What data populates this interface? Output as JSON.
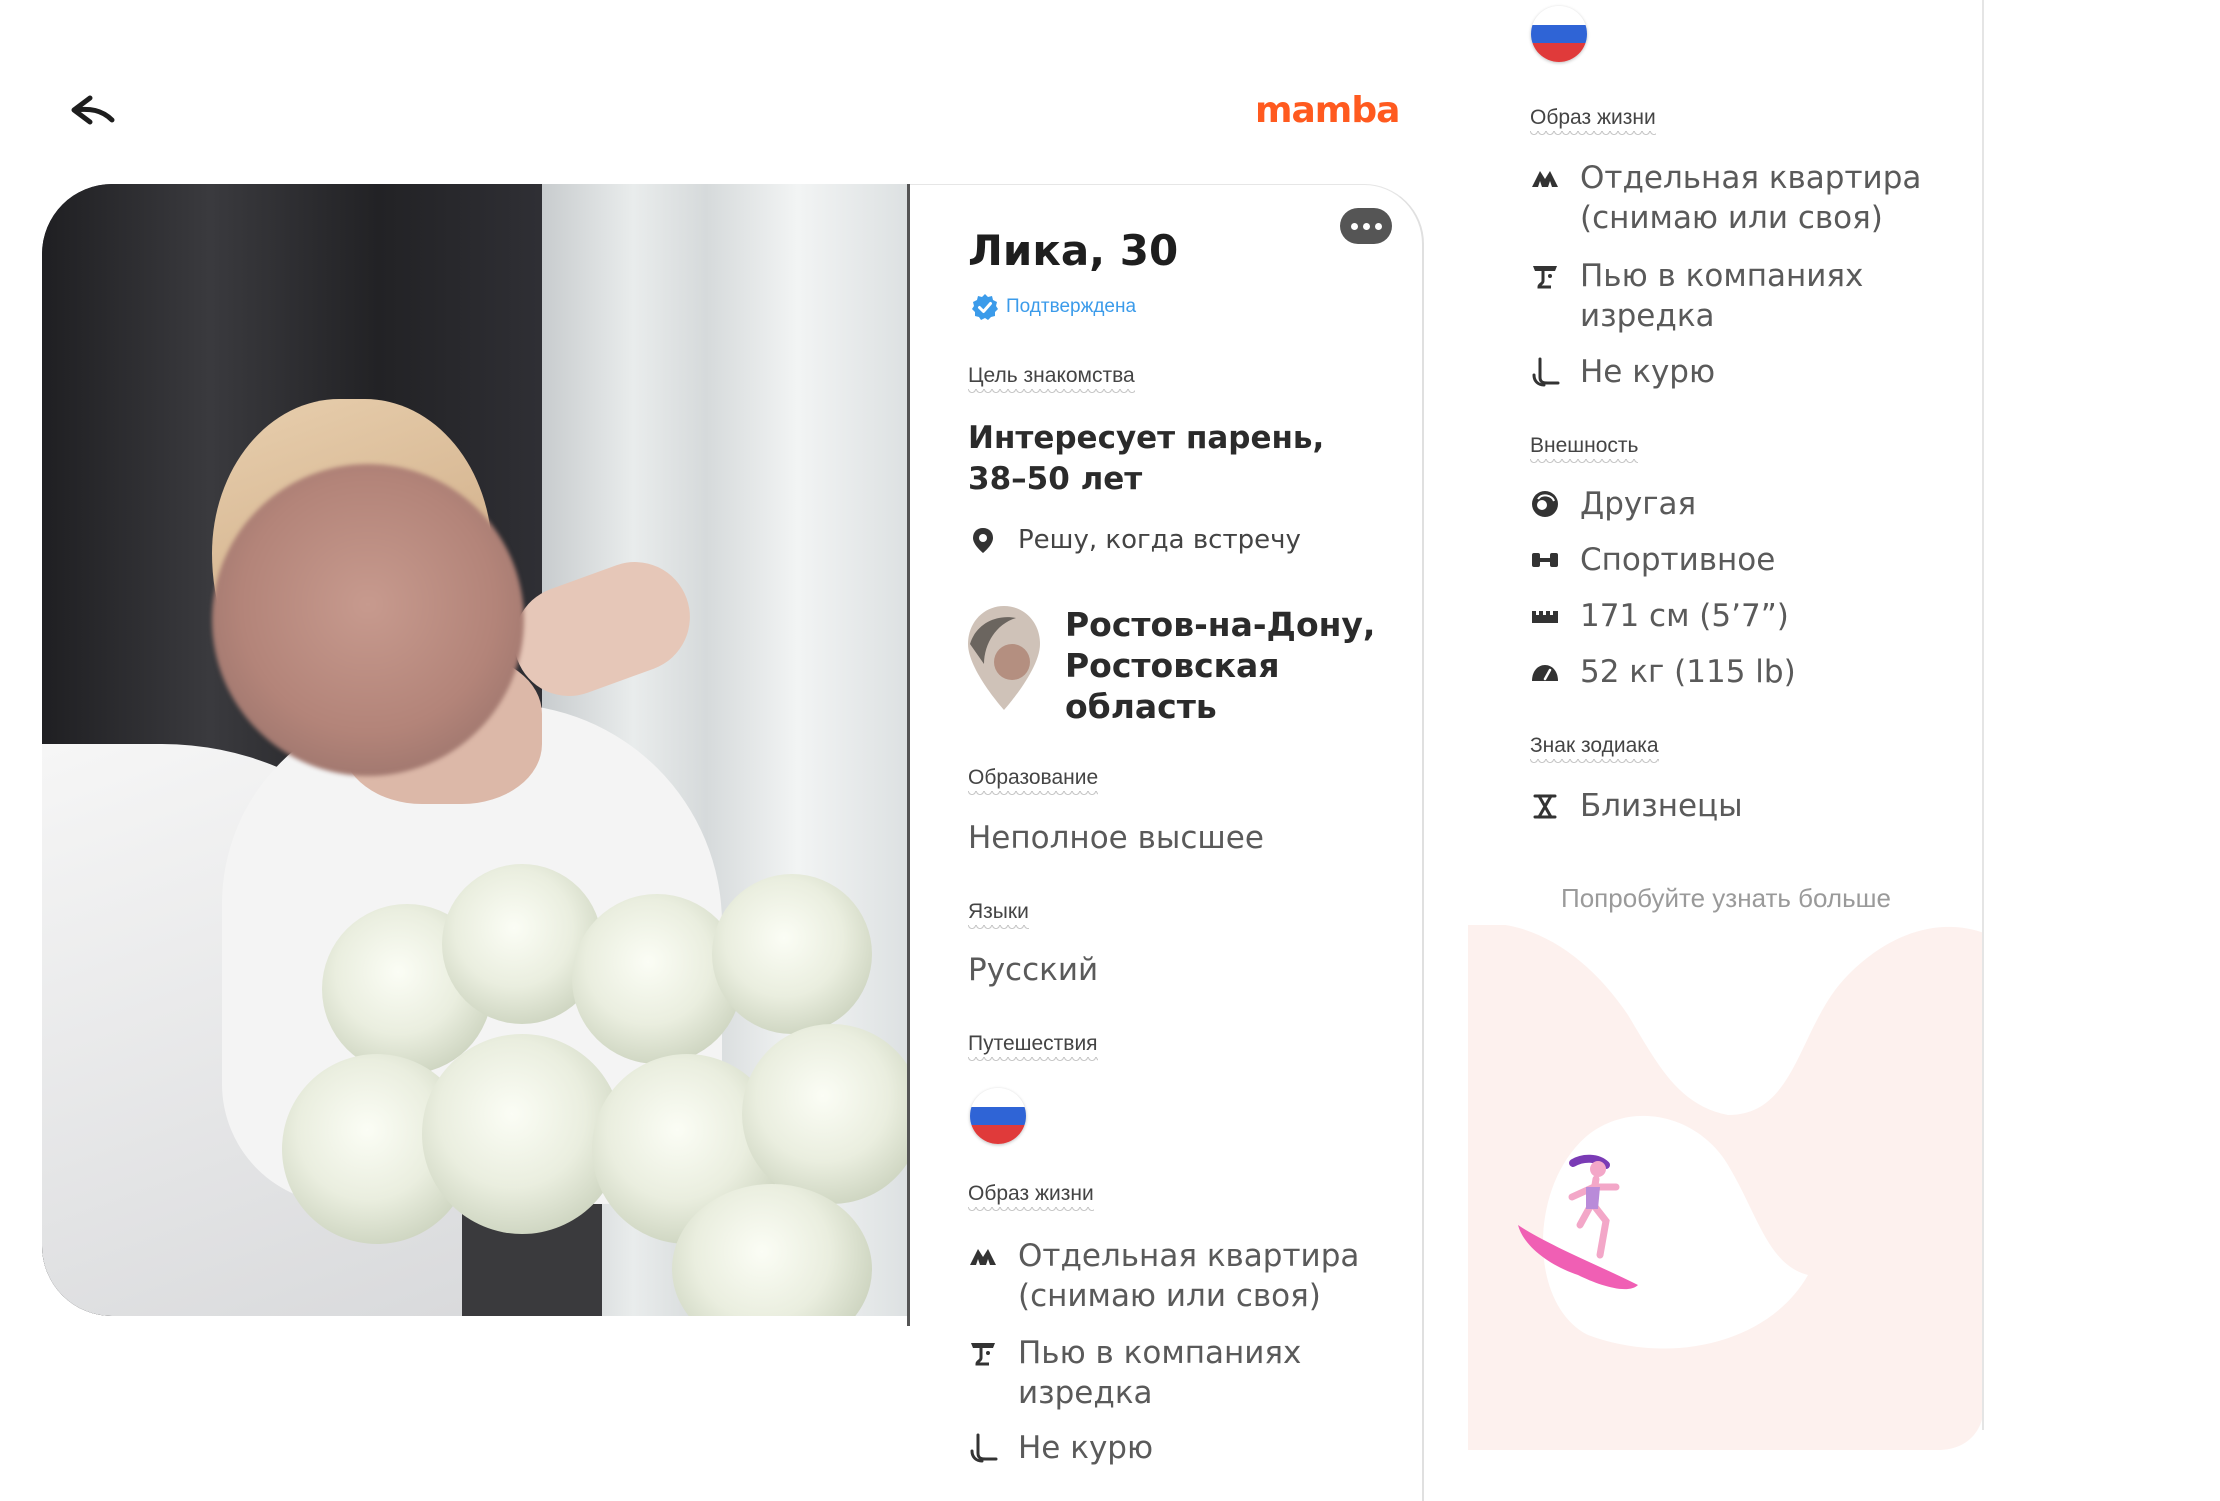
{
  "header": {
    "logo": "mamba",
    "back_icon": "arrow-left-icon"
  },
  "profile": {
    "name_age": "Лика, 30",
    "verified_label": "Подтверждена",
    "menu_icon": "more-dots-icon"
  },
  "goal": {
    "label": "Цель знакомства",
    "text": "Интересует парень, 38–50 лет",
    "meeting": "Решу, когда встречу"
  },
  "location": {
    "text": "Ростов-на-Дону, Ростовская область"
  },
  "education": {
    "label": "Образование",
    "value": "Неполное высшее"
  },
  "languages": {
    "label": "Языки",
    "value": "Русский"
  },
  "travel": {
    "label": "Путешествия",
    "flag": "russia-flag"
  },
  "lifestyle": {
    "label": "Образ жизни",
    "items": [
      {
        "icon": "housing-icon",
        "text": "Отдельная квартира (снимаю или своя)"
      },
      {
        "icon": "drink-icon",
        "text": "Пью в компаниях изредка"
      },
      {
        "icon": "no-smoking-icon",
        "text": "Не курю"
      }
    ]
  },
  "appearance": {
    "label": "Внешность",
    "items": [
      {
        "icon": "face-icon",
        "text": "Другая"
      },
      {
        "icon": "dumbbell-icon",
        "text": "Спортивное"
      },
      {
        "icon": "ruler-icon",
        "text": "171 см (5’7”)"
      },
      {
        "icon": "weight-icon",
        "text": "52 кг (115 lb)"
      }
    ]
  },
  "zodiac": {
    "label": "Знак зодиака",
    "icon": "gemini-icon",
    "value": "Близнецы"
  },
  "teaser": "Попробуйте узнать больше",
  "colors": {
    "brand": "#ff5a1f",
    "verified": "#3b9bea",
    "flag": [
      "#ffffff",
      "#2f64d6",
      "#e03a3a"
    ]
  }
}
